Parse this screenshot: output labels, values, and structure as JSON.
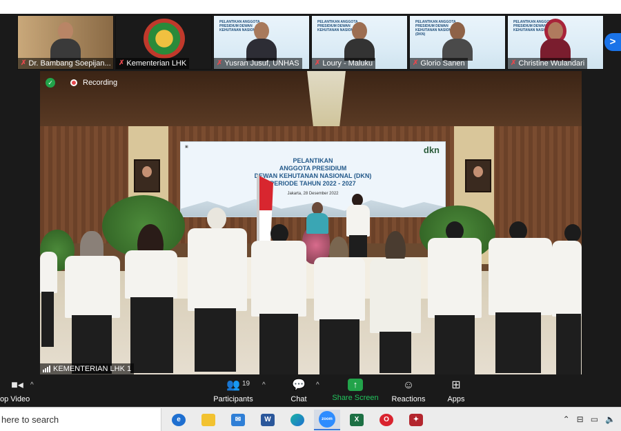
{
  "participants_strip": [
    {
      "name": "Dr. Bambang Soepijan...",
      "muted": true,
      "icon": "person-video"
    },
    {
      "name": "Kementerian LHK",
      "muted": true,
      "icon": "ministry-logo"
    },
    {
      "name": "Yusran Jusuf, UNHAS",
      "muted": true,
      "icon": "person-video"
    },
    {
      "name": "Loury - Maluku",
      "muted": true,
      "icon": "person-video"
    },
    {
      "name": "Glorio Sanen",
      "muted": true,
      "icon": "person-video"
    },
    {
      "name": "Christine Wulandari",
      "muted": true,
      "icon": "person-video"
    }
  ],
  "next_page_icon": ">",
  "recording": {
    "label": "Recording"
  },
  "event_screen": {
    "line1": "PELANTIKAN",
    "line2": "ANGGOTA PRESIDIUM",
    "line3": "DEWAN KEHUTANAN NASIONAL (DKN)",
    "line4": "PERIODE TAHUN 2022 - 2027",
    "date": "Jakarta, 28 Desember 2022",
    "logo_right": "dkn"
  },
  "active_speaker": {
    "name": "KEMENTERIAN LHK 1"
  },
  "controls": {
    "video_label": "op Video",
    "participants_label": "Participants",
    "participants_count": "19",
    "chat_label": "Chat",
    "share_label": "Share Screen",
    "reactions_label": "Reactions",
    "apps_label": "Apps"
  },
  "taskbar": {
    "search_text": "here to search",
    "apps": [
      "edge-icon-blue",
      "file-explorer",
      "mail",
      "word",
      "edge",
      "zoom",
      "excel",
      "opera",
      "app-red"
    ],
    "zoom_label": "zoom",
    "word_label": "W",
    "excel_label": "X",
    "opera_label": "O"
  },
  "colors": {
    "accent_green": "#22c55e",
    "mute_red": "#e5484d",
    "next_blue": "#1a73e8"
  }
}
